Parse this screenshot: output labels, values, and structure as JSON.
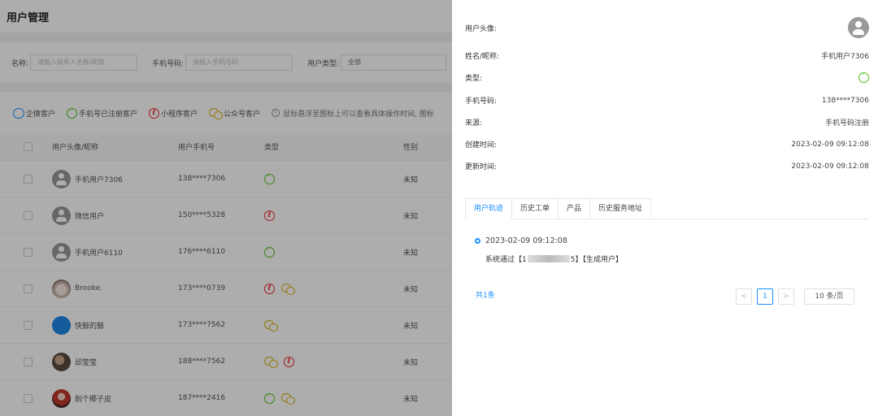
{
  "page": {
    "title": "用户管理"
  },
  "filters": {
    "name_label": "名称:",
    "name_placeholder": "请输入联系人名称/昵称",
    "phone_label": "手机号码:",
    "phone_placeholder": "请输入手机号码",
    "type_label": "用户类型:",
    "type_value": "全部"
  },
  "legend": {
    "qw": "企微客户",
    "phone": "手机号已注册客户",
    "mini": "小程序客户",
    "gzh": "公众号客户",
    "tip": "鼠标悬浮至图标上可以查看具体操作时间, 图标"
  },
  "table": {
    "headers": {
      "name": "用户头像/昵称",
      "phone": "用户手机号",
      "type": "类型",
      "gender": "性别"
    },
    "rows": [
      {
        "name": "手机用户7306",
        "phone": "138****7306",
        "gender": "未知",
        "avatar": "default",
        "icons": [
          "wx"
        ]
      },
      {
        "name": "微信用户",
        "phone": "150****5328",
        "gender": "未知",
        "avatar": "default",
        "icons": [
          "mini"
        ]
      },
      {
        "name": "手机用户6110",
        "phone": "176****6110",
        "gender": "未知",
        "avatar": "default",
        "icons": [
          "wx"
        ]
      },
      {
        "name": "Brooke.",
        "phone": "173****0739",
        "gender": "未知",
        "avatar": "cat",
        "icons": [
          "mini",
          "gzh"
        ]
      },
      {
        "name": "快鲸的鲸",
        "phone": "173****7562",
        "gender": "未知",
        "avatar": "whale",
        "icons": [
          "gzh"
        ]
      },
      {
        "name": "邱莹莹",
        "phone": "188****7562",
        "gender": "未知",
        "avatar": "photo",
        "icons": [
          "gzh",
          "mini"
        ]
      },
      {
        "name": "削个椰子皮",
        "phone": "187****2416",
        "gender": "未知",
        "avatar": "red",
        "icons": [
          "wx",
          "gzh"
        ]
      }
    ]
  },
  "drawer": {
    "avatar_label": "用户头像:",
    "name_label": "姓名/昵称:",
    "name_value": "手机用户7306",
    "type_label": "类型:",
    "phone_label": "手机号码:",
    "phone_value": "138****7306",
    "source_label": "来源:",
    "source_value": "手机号码注册",
    "created_label": "创建时间:",
    "created_value": "2023-02-09 09:12:08",
    "updated_label": "更新时间:",
    "updated_value": "2023-02-09 09:12:08",
    "tabs": [
      "用户轨迹",
      "历史工单",
      "产品",
      "历史服务地址"
    ],
    "timeline": {
      "time": "2023-02-09 09:12:08",
      "text_prefix": "系统通过【1",
      "text_suffix": "5】【生成用户】"
    },
    "pagination": {
      "total": "共1条",
      "prev": "<",
      "page": "1",
      "next": ">",
      "page_size": "10 条/页"
    }
  }
}
